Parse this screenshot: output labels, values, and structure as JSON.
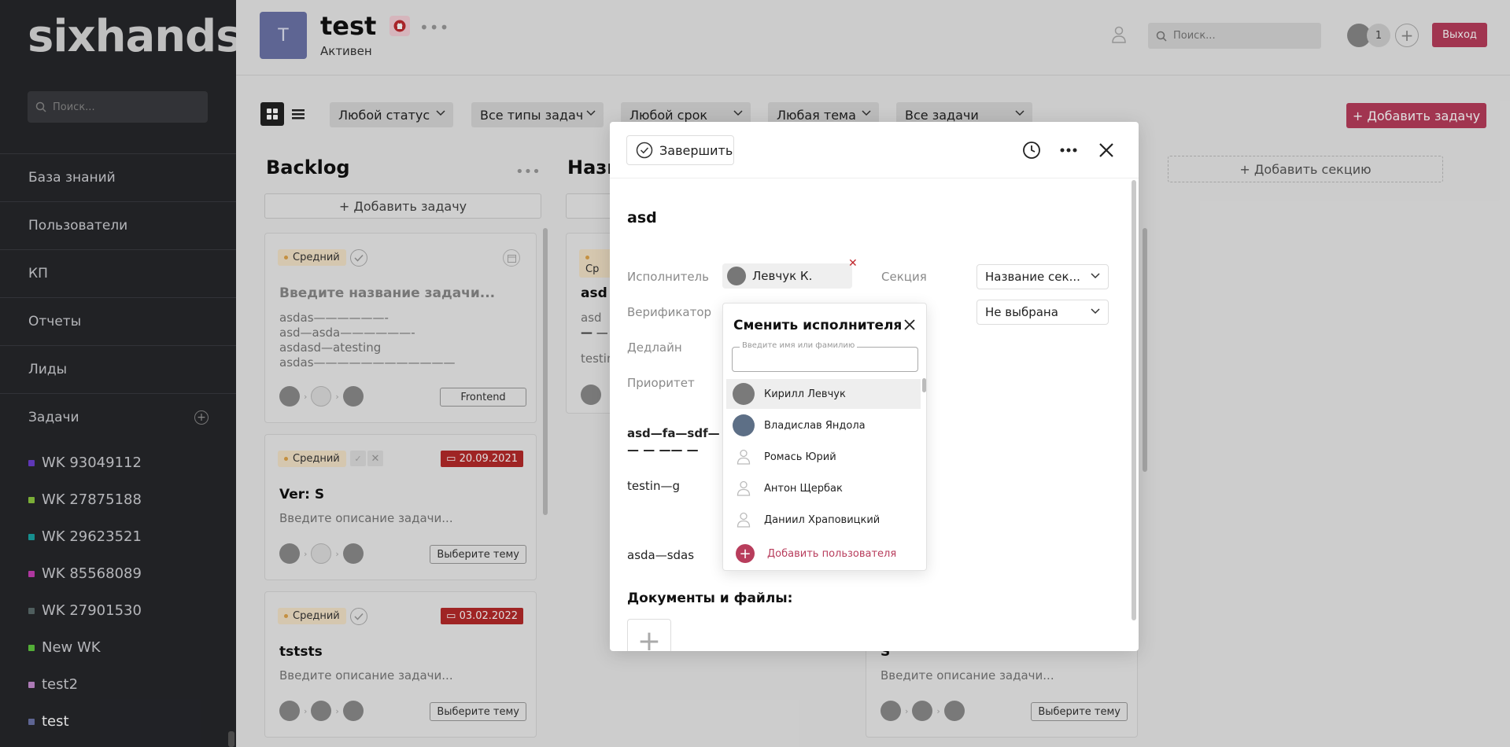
{
  "sidebar": {
    "logo": "sixhands",
    "search_placeholder": "Поиск...",
    "nav": [
      {
        "label": "База знаний"
      },
      {
        "label": "Пользователи"
      },
      {
        "label": "КП"
      },
      {
        "label": "Отчеты"
      },
      {
        "label": "Лиды"
      },
      {
        "label": "Задачи"
      }
    ],
    "projects": [
      {
        "label": "WK 93049112",
        "color": "#6b3fd0"
      },
      {
        "label": "WK 27875188",
        "color": "#8dc63f"
      },
      {
        "label": "WK 29623521",
        "color": "#1aa3a3"
      },
      {
        "label": "WK 85568089",
        "color": "#c63fb5"
      },
      {
        "label": "WK 27901530",
        "color": "#5b6b6b"
      },
      {
        "label": "New WK",
        "color": "#5fc63f"
      },
      {
        "label": "test2",
        "color": "#c48bd0"
      },
      {
        "label": "test",
        "color": "#6b74a8"
      }
    ]
  },
  "header": {
    "avatar_letter": "T",
    "title": "test",
    "status": "Активен",
    "search_placeholder": "Поиск...",
    "user_count": "1",
    "exit_label": "Выход"
  },
  "toolbar": {
    "filters": [
      "Любой статус",
      "Все типы задач",
      "Любой срок",
      "Любая тема",
      "Все задачи"
    ],
    "add_task_label": "+ Добавить задачу"
  },
  "board": {
    "col1_title": "Backlog",
    "col2_title": "Назв",
    "add_in_col": "+ Добавить задачу",
    "add_section": "+ Добавить секцию",
    "cards": [
      {
        "priority": "Средний",
        "title": "Введите название задачи...",
        "lines": [
          "asdas——————-",
          "asd—asda——————-",
          "asdasd—atesting",
          "asdas————————————"
        ],
        "tag": "Frontend"
      },
      {
        "priority": "Средний",
        "date": "20.09.2021",
        "title": "Ver: S",
        "desc": "Введите описание задачи...",
        "tag": "Выберите тему"
      },
      {
        "priority": "Средний",
        "date": "03.02.2022",
        "title": "tststs",
        "desc": "Введите описание задачи...",
        "tag": "Выберите тему"
      }
    ],
    "col2_card1": {
      "priority": "Ср",
      "title": "asd",
      "line1": "asd—",
      "line2": "— —",
      "line3": "testin"
    },
    "col3_card": {
      "title": "S",
      "desc": "Введите описание задачи...",
      "tag": "Выберите тему"
    }
  },
  "modal": {
    "finish_label": "Завершить",
    "title": "asd",
    "labels": {
      "executor": "Исполнитель",
      "verifier": "Верификатор",
      "deadline": "Дедлайн",
      "priority": "Приоритет",
      "section": "Секция"
    },
    "executor_name": "Левчук К.",
    "section_value": "Название сек...",
    "verifier_value": "Не выбрана",
    "body_lines": [
      "asd—fa—sdf—",
      "— — —— —",
      "testin—g",
      "asda—sdas"
    ],
    "docs_label": "Документы и файлы:"
  },
  "dropdown": {
    "title": "Сменить исполнителя",
    "input_label": "Введите имя или фамилию",
    "users": [
      {
        "name": "Кирилл Левчук",
        "has_photo": true
      },
      {
        "name": "Владислав Яндола",
        "has_photo": true
      },
      {
        "name": "Ромась Юрий",
        "has_photo": false
      },
      {
        "name": "Антон Щербак",
        "has_photo": false
      },
      {
        "name": "Даниил Храповицкий",
        "has_photo": false
      }
    ],
    "add_user_label": "Добавить пользователя"
  }
}
